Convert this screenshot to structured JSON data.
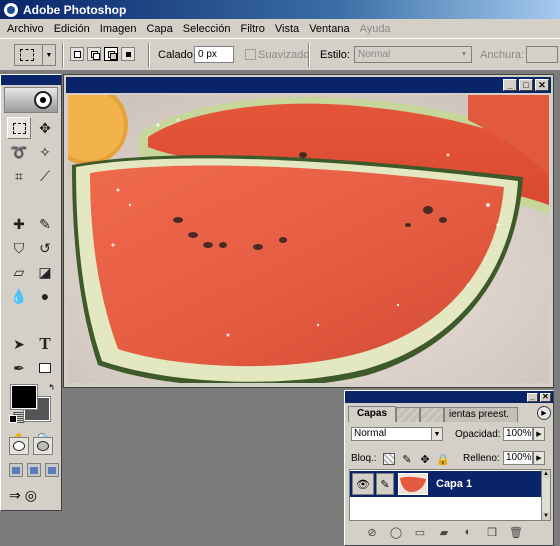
{
  "app": {
    "title": "Adobe Photoshop"
  },
  "menu": [
    "Archivo",
    "Edición",
    "Imagen",
    "Capa",
    "Selección",
    "Filtro",
    "Vista",
    "Ventana",
    "Ayuda"
  ],
  "options": {
    "feather_label": "Calado:",
    "feather_value": "0 px",
    "antialias_label": "Suavizado",
    "style_label": "Estilo:",
    "style_value": "Normal",
    "width_label": "Anchura:"
  },
  "layers_panel": {
    "tabs": [
      "Capas",
      "",
      "",
      "ientas preest."
    ],
    "blend_mode": "Normal",
    "opacity_label": "Opacidad:",
    "opacity_value": "100%",
    "lock_label": "Bloq.:",
    "fill_label": "Relleno:",
    "fill_value": "100%",
    "layers": [
      {
        "name": "Capa 1",
        "visible": true,
        "selected": true
      }
    ]
  },
  "colors": {
    "title_bar": "#0a246a",
    "chrome": "#d4d0c8",
    "workspace": "#7c7c7c",
    "foreground": "#000000",
    "background": "#555555"
  },
  "icons": {
    "tools": [
      "rectangular-marquee-icon",
      "move-icon",
      "lasso-icon",
      "magic-wand-icon",
      "crop-icon",
      "slice-icon",
      "healing-brush-icon",
      "brush-icon",
      "clone-stamp-icon",
      "history-brush-icon",
      "eraser-icon",
      "paint-bucket-icon",
      "blur-icon",
      "dodge-icon",
      "path-selection-icon",
      "type-icon",
      "pen-icon",
      "rectangle-shape-icon",
      "notes-icon",
      "eyedropper-icon",
      "hand-icon",
      "zoom-icon"
    ]
  }
}
